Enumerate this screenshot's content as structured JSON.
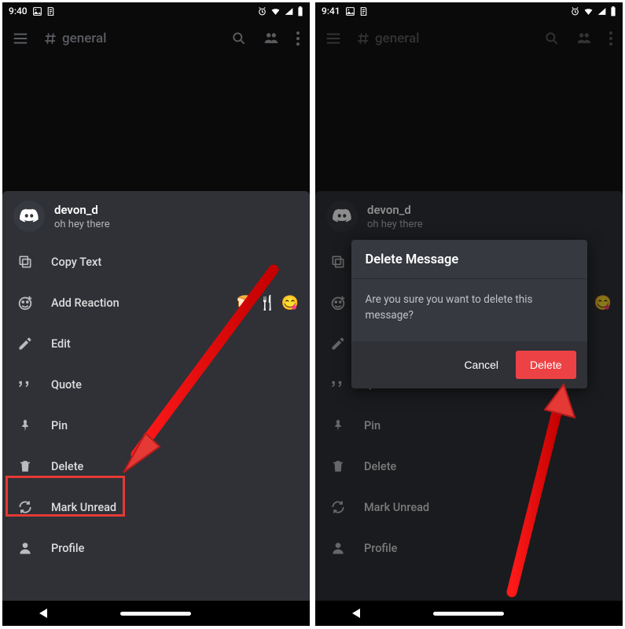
{
  "left": {
    "statusbar": {
      "time": "9:40"
    },
    "appbar": {
      "channel": "general"
    },
    "message": {
      "username": "devon_d",
      "content": "oh hey there"
    },
    "menu": {
      "copy_text": "Copy Text",
      "add_reaction": "Add Reaction",
      "edit": "Edit",
      "quote": "Quote",
      "pin": "Pin",
      "delete": "Delete",
      "mark_unread": "Mark Unread",
      "profile": "Profile"
    },
    "reactions": {
      "bread": "🍞",
      "cutlery": "🍴",
      "yum": "😋"
    }
  },
  "right": {
    "statusbar": {
      "time": "9:41"
    },
    "appbar": {
      "channel": "general"
    },
    "message": {
      "username": "devon_d",
      "content": "oh hey there"
    },
    "menu": {
      "copy_text": "Copy Text",
      "add_reaction": "Add Reaction",
      "edit": "Edit",
      "quote": "Quote",
      "pin": "Pin",
      "delete": "Delete",
      "mark_unread": "Mark Unread",
      "profile": "Profile"
    },
    "reactions": {
      "yum": "😋"
    },
    "dialog": {
      "title": "Delete Message",
      "body": "Are you sure you want to delete this message?",
      "cancel": "Cancel",
      "delete": "Delete"
    }
  },
  "colors": {
    "accent_red": "#ed4245",
    "highlight": "#e53935"
  }
}
